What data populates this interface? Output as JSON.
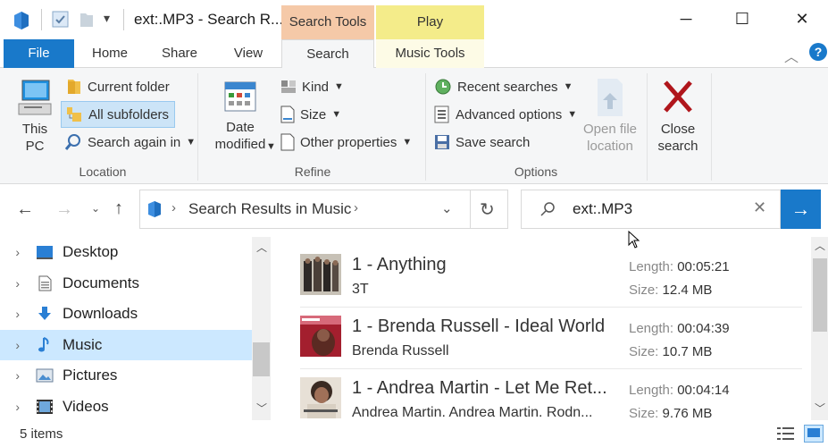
{
  "window": {
    "title": "ext:.MP3 - Search R...",
    "minimize_icon": "─",
    "maximize_icon": "☐",
    "close_icon": "✕"
  },
  "context_tabs": {
    "search_tools": "Search Tools",
    "play": "Play"
  },
  "ribbon_tabs": {
    "file": "File",
    "home": "Home",
    "share": "Share",
    "view": "View",
    "search": "Search",
    "music_tools": "Music Tools"
  },
  "ribbon": {
    "location": {
      "label": "Location",
      "this_pc": "This\nPC",
      "current_folder": "Current folder",
      "all_subfolders": "All subfolders",
      "search_again_in": "Search again in"
    },
    "refine": {
      "label": "Refine",
      "date_modified": "Date\nmodified",
      "kind": "Kind",
      "size": "Size",
      "other_properties": "Other properties"
    },
    "options": {
      "label": "Options",
      "recent_searches": "Recent searches",
      "advanced_options": "Advanced options",
      "save_search": "Save search",
      "open_file_location": "Open file\nlocation"
    },
    "close": {
      "close_search": "Close\nsearch"
    }
  },
  "address": {
    "path": "Search Results in Music"
  },
  "search": {
    "query": "ext:.MP3"
  },
  "nav_pane": {
    "items": [
      {
        "label": "Desktop"
      },
      {
        "label": "Documents"
      },
      {
        "label": "Downloads"
      },
      {
        "label": "Music",
        "selected": true
      },
      {
        "label": "Pictures"
      },
      {
        "label": "Videos"
      }
    ]
  },
  "results": [
    {
      "name": "1 - Anything",
      "artist": "3T",
      "length_label": "Length:",
      "length": "00:05:21",
      "size_label": "Size:",
      "size": "12.4 MB"
    },
    {
      "name": "1 - Brenda Russell - Ideal World",
      "artist": "Brenda Russell",
      "length_label": "Length:",
      "length": "00:04:39",
      "size_label": "Size:",
      "size": "10.7 MB"
    },
    {
      "name": "1 - Andrea Martin - Let Me Ret...",
      "artist": "Andrea Martin. Andrea Martin. Rodn...",
      "length_label": "Length:",
      "length": "00:04:14",
      "size_label": "Size:",
      "size": "9.76 MB"
    }
  ],
  "status": {
    "items_count": "5 items"
  },
  "colors": {
    "accent": "#1979ca",
    "search_tools_tab": "#f5c9a8",
    "play_tab": "#f4ec8a",
    "nav_selected": "#cce8ff"
  }
}
